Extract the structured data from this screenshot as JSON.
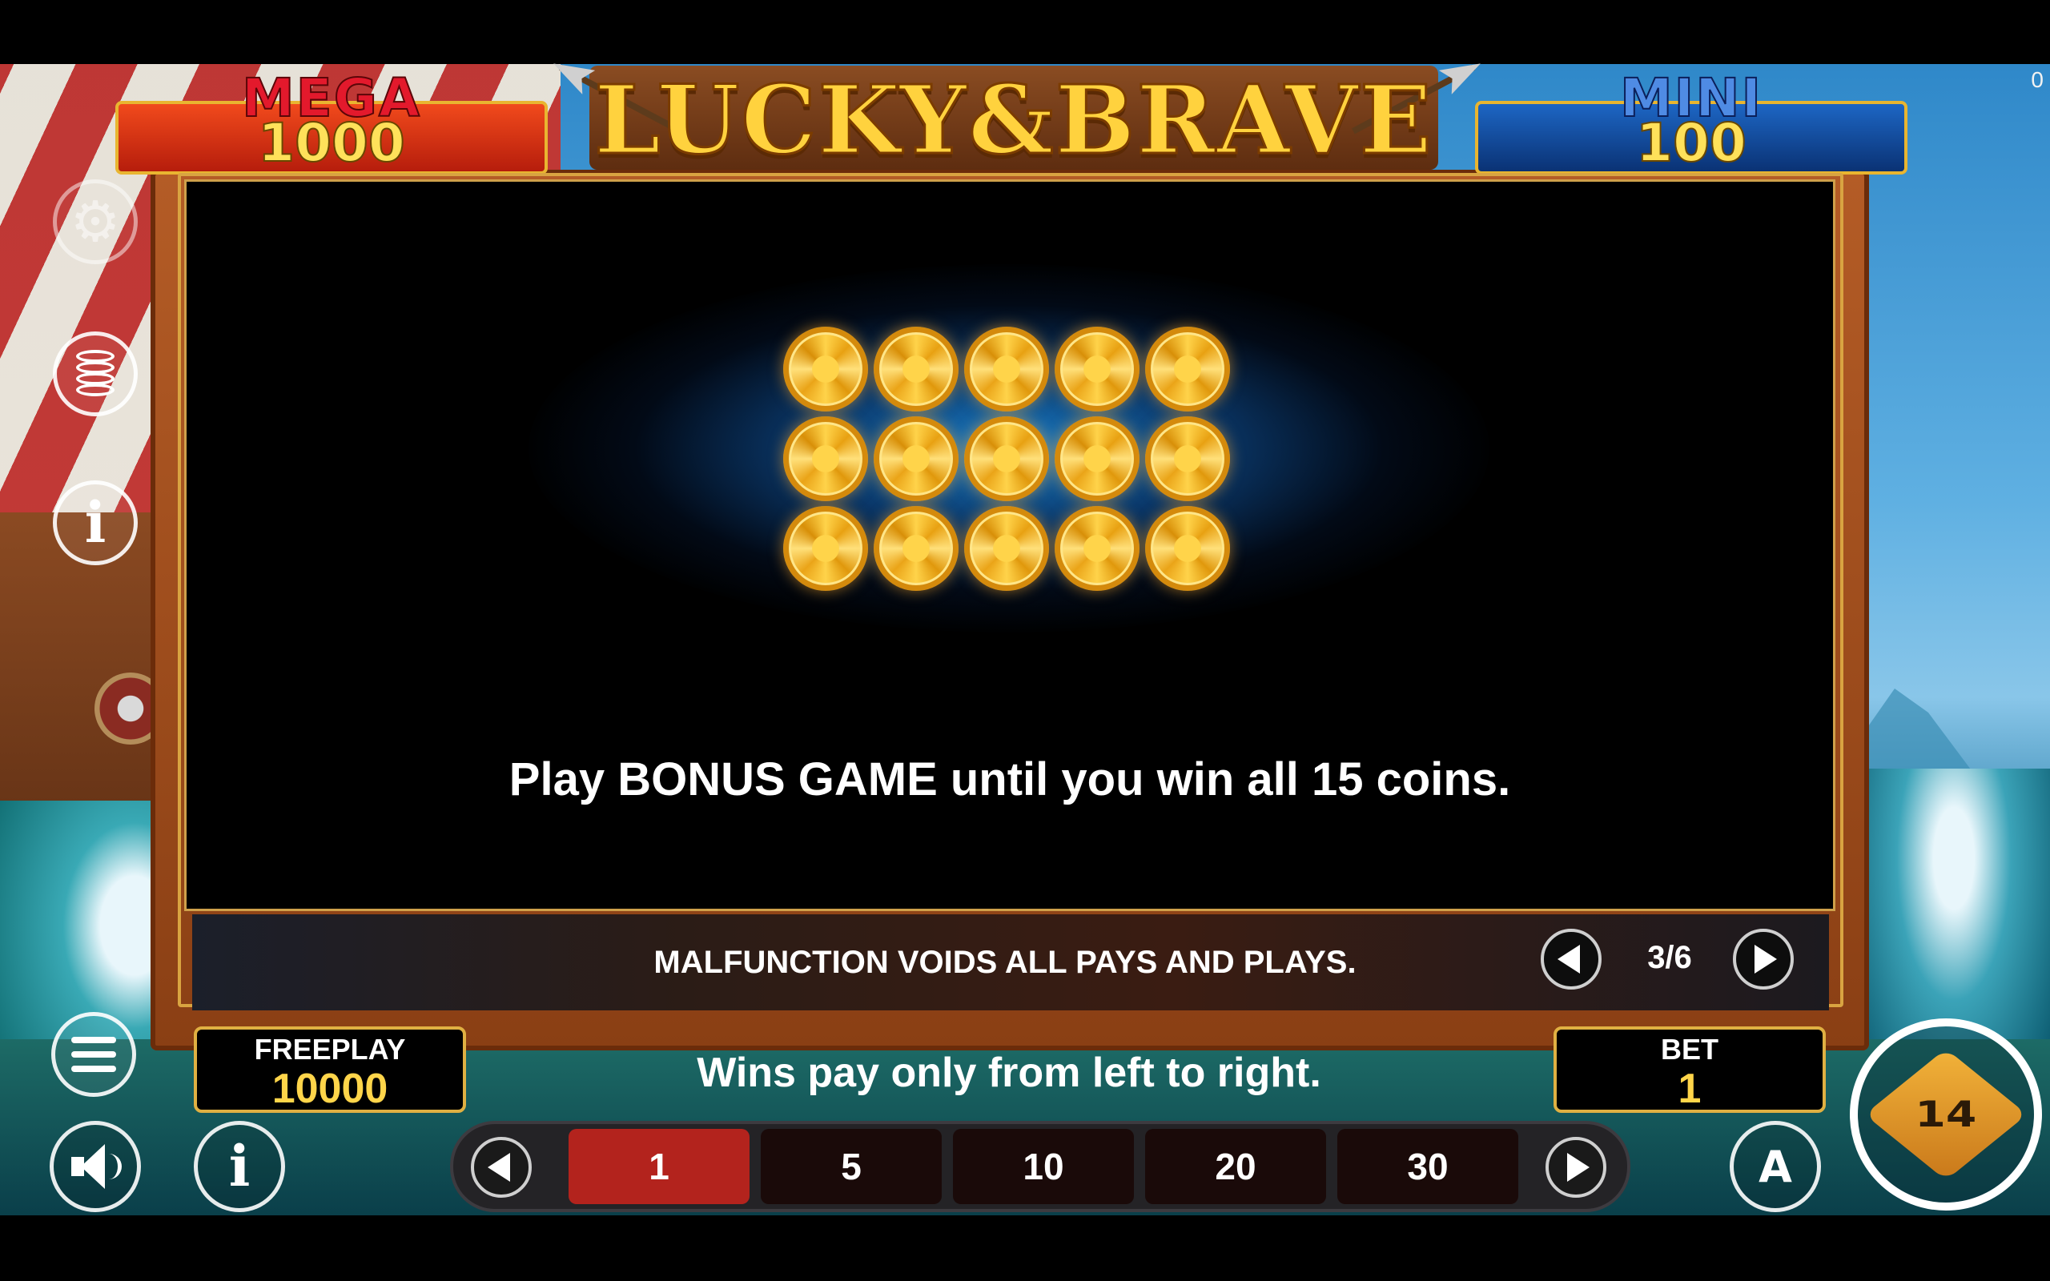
{
  "game": {
    "title": "LUCKY&BRAVE",
    "corner_counter": "0"
  },
  "jackpots": {
    "mega": {
      "label": "MEGA",
      "value": "1000"
    },
    "mini": {
      "label": "MINI",
      "value": "100"
    }
  },
  "paytable": {
    "page_text": "Play BONUS GAME until you win all 15 coins.",
    "page_indicator": "3/6",
    "coin_count": 15,
    "prev_page_icon": "triangle-left-icon",
    "next_page_icon": "triangle-right-icon"
  },
  "footer": {
    "disclaimer": "MALFUNCTION VOIDS ALL PAYS AND PLAYS.",
    "wins_text": "Wins pay only from left to right."
  },
  "freeplay": {
    "label": "FREEPLAY",
    "value": "10000"
  },
  "bet": {
    "label": "BET",
    "value": "1",
    "options": [
      "1",
      "5",
      "10",
      "20",
      "30"
    ],
    "selected_index": 0
  },
  "side_icons": [
    "gear-icon",
    "coins-stack-icon",
    "info-icon",
    "menu-icon"
  ],
  "controls": {
    "sound_icon": "speaker-icon",
    "info_icon": "info-icon",
    "autoplay_label": "A",
    "spin_label": "1",
    "spin_sub_label": "4"
  },
  "colors": {
    "mega_red": "#c9240f",
    "mini_blue": "#0f4aa3",
    "gold_border": "#e0b042",
    "value_yellow": "#ffd54a",
    "selected_bet": "#b3231d"
  }
}
